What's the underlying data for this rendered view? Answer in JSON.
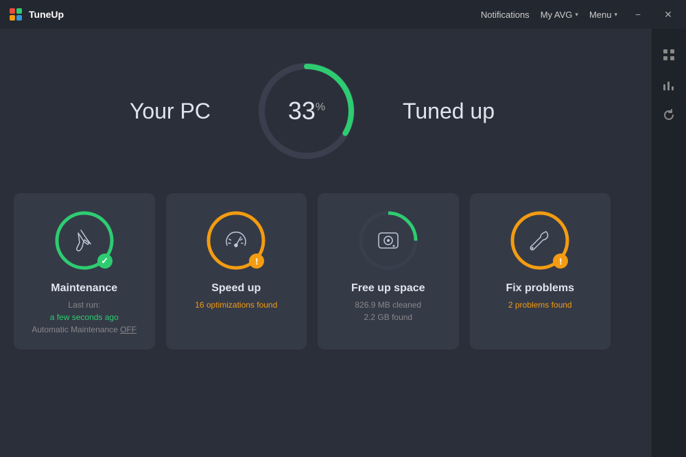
{
  "app": {
    "name": "TuneUp",
    "logo_colors": [
      "#e74c3c",
      "#2ecc71",
      "#f39c12",
      "#3498db"
    ]
  },
  "titlebar": {
    "notifications_label": "Notifications",
    "my_avg_label": "My AVG",
    "menu_label": "Menu"
  },
  "sidebar": {
    "icons": [
      "apps",
      "chart",
      "refresh"
    ]
  },
  "gauge": {
    "your_pc_label": "Your PC",
    "tuned_up_label": "Tuned up",
    "percent_value": "33",
    "percent_sign": "%",
    "arc_color": "#2ecc71",
    "bg_color": "#3a3f4e"
  },
  "cards": [
    {
      "id": "maintenance",
      "title": "Maintenance",
      "subtitle_line1": "Last run:",
      "subtitle_line2": "a few seconds ago",
      "subtitle_line3": "Automatic Maintenance ",
      "subtitle_link": "OFF",
      "status": "ok",
      "ring_color": "#2ecc71"
    },
    {
      "id": "speed-up",
      "title": "Speed up",
      "subtitle_line1": "16 optimizations found",
      "subtitle_line2": "",
      "subtitle_line3": "",
      "subtitle_link": "",
      "status": "warn",
      "ring_color": "#f39c12"
    },
    {
      "id": "free-space",
      "title": "Free up space",
      "subtitle_line1": "826.9 MB cleaned",
      "subtitle_line2": "2.2 GB found",
      "subtitle_line3": "",
      "subtitle_link": "",
      "status": "none",
      "ring_color": "#3a3f4e"
    },
    {
      "id": "fix-problems",
      "title": "Fix problems",
      "subtitle_line1": "2 problems found",
      "subtitle_line2": "",
      "subtitle_line3": "",
      "subtitle_link": "",
      "status": "warn",
      "ring_color": "#f39c12"
    }
  ]
}
